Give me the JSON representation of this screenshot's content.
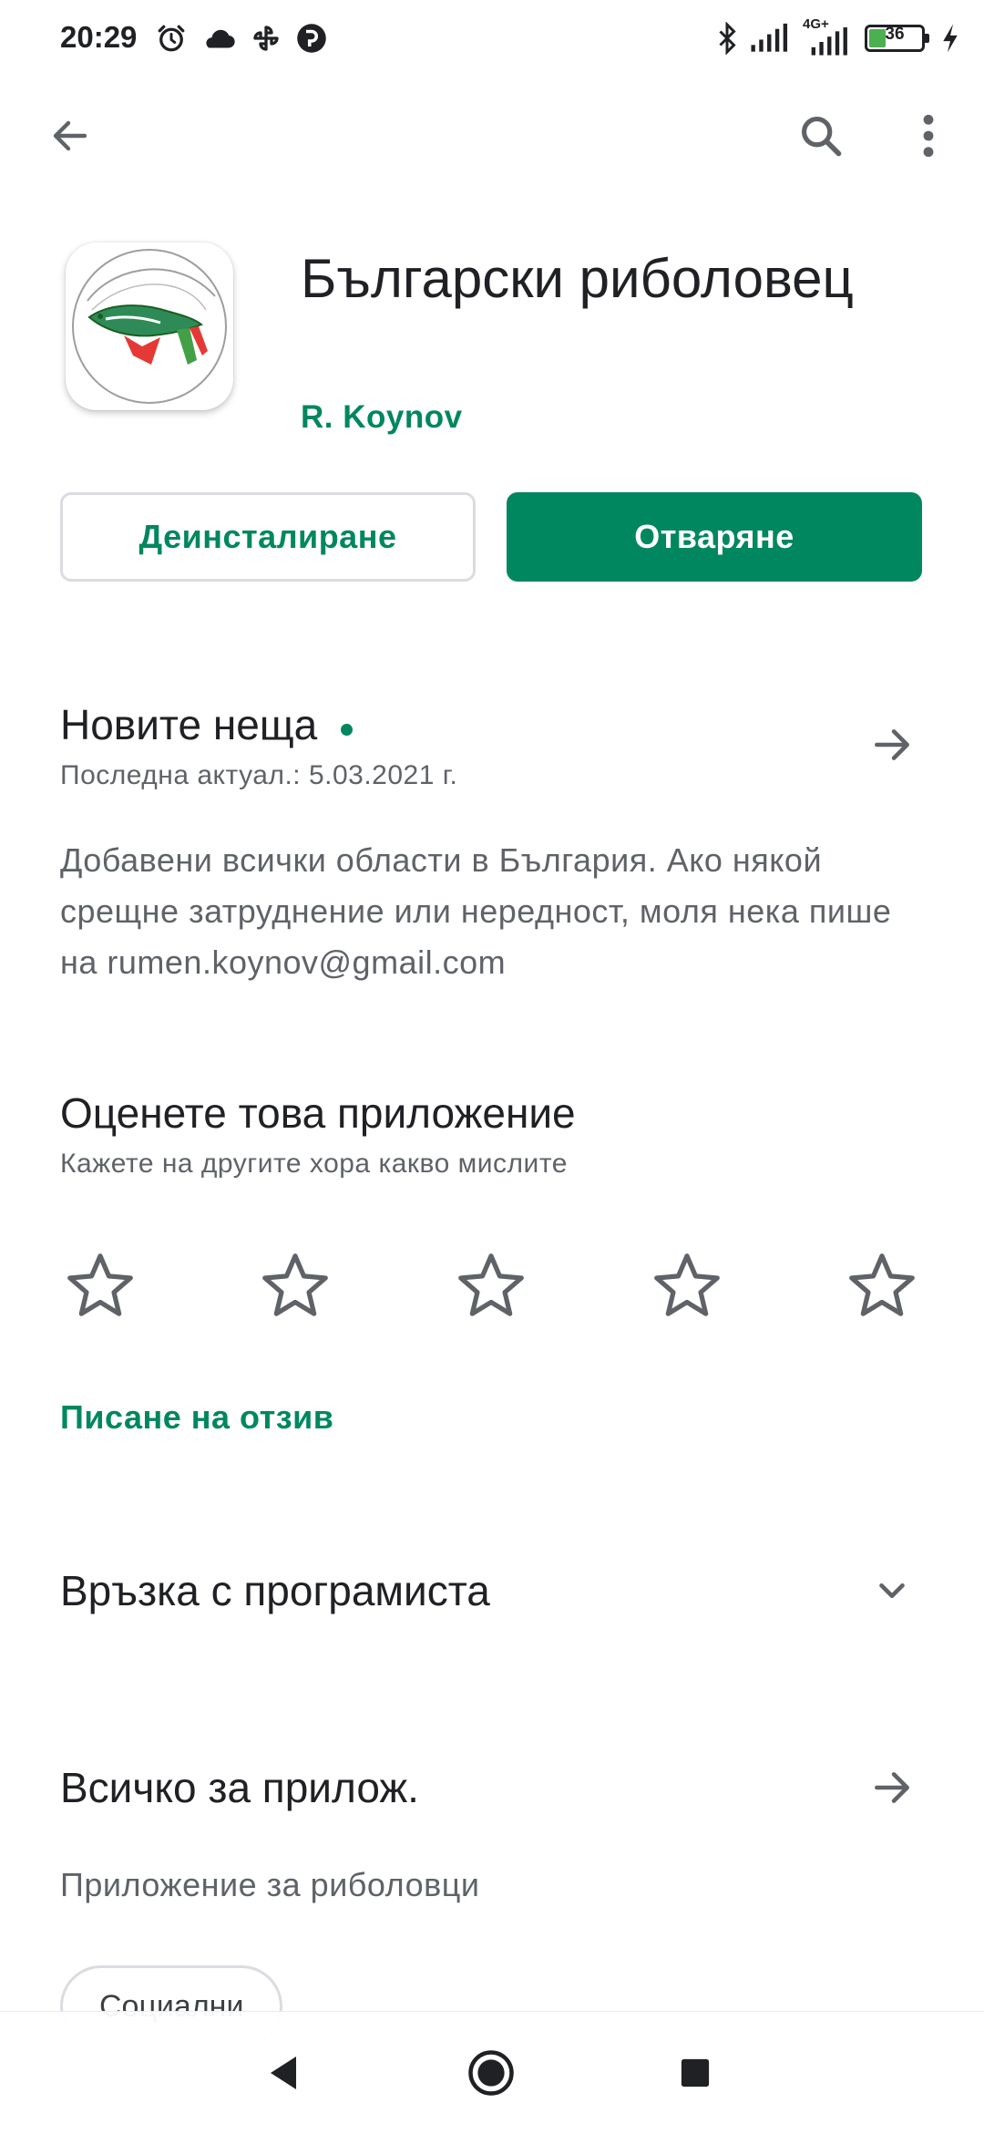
{
  "status_bar": {
    "time": "20:29",
    "battery_level": "36",
    "network_label": "4G+",
    "left_icons": [
      "alarm-icon",
      "cloud-icon",
      "pinwheel-icon",
      "app-notification-icon"
    ],
    "right_icons": [
      "bluetooth-icon",
      "signal-icon",
      "signal-4g-icon",
      "battery-icon",
      "charging-icon"
    ]
  },
  "toolbar": {
    "icons": [
      "back-arrow-icon",
      "search-icon",
      "more-vert-icon"
    ]
  },
  "app": {
    "title": "Български риболовец",
    "developer": "R. Koynov",
    "uninstall_label": "Деинсталиране",
    "open_label": "Отваряне"
  },
  "whats_new": {
    "title": "Новите неща",
    "updated": "Последна актуал.: 5.03.2021 г.",
    "body": "Добавени всички области в България. Ако някой срещне затруднение или нередност, моля нека пише на rumen.koynov@gmail.com"
  },
  "rate": {
    "title": "Оценете това приложение",
    "subtitle": "Кажете на другите хора какво мислите",
    "stars_selected": 0,
    "stars_total": 5,
    "write_review": "Писане на отзив"
  },
  "developer_contact": {
    "title": "Връзка с програмиста"
  },
  "about": {
    "title": "Всичко за прилож.",
    "description": "Приложение за риболовци",
    "chip": "Социални"
  },
  "colors": {
    "accent": "#01875f",
    "text_primary": "#202124",
    "text_secondary": "#5f6368",
    "border": "#dadce0"
  },
  "nav_bar": {
    "icons": [
      "nav-back-icon",
      "nav-home-icon",
      "nav-recents-icon"
    ]
  }
}
